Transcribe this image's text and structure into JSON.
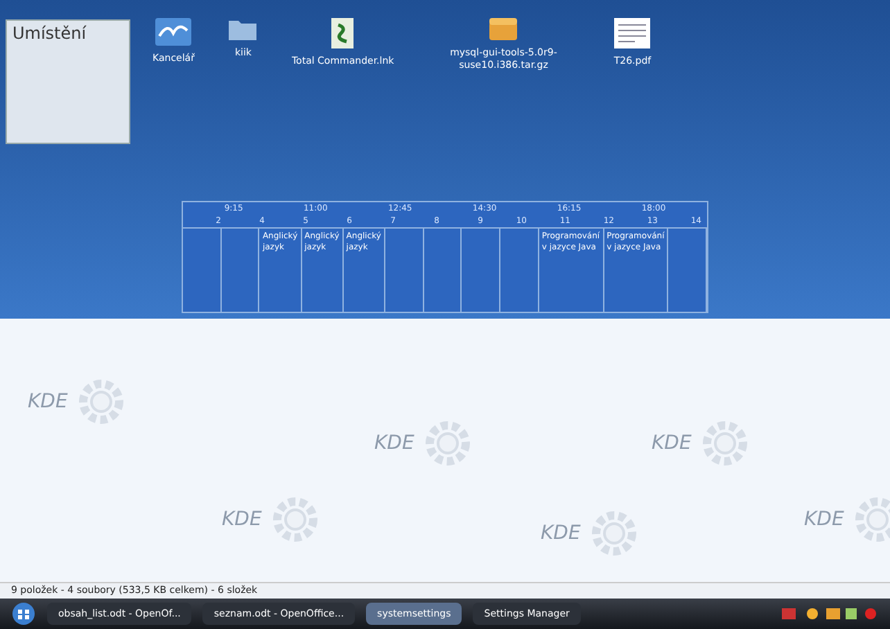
{
  "desktop_icons": [
    {
      "label": "Kancelář",
      "kind": "app"
    },
    {
      "label": "kiik",
      "kind": "folder"
    },
    {
      "label": "Total Commander.lnk",
      "kind": "shortcut"
    },
    {
      "label": "mysql-gui-tools-5.0r9-suse10.i386.tar.gz",
      "kind": "archive"
    },
    {
      "label": "T26.pdf",
      "kind": "document"
    }
  ],
  "side_window": {
    "title": "Umístění"
  },
  "timetable": {
    "times": [
      "9:15",
      "11:00",
      "12:45",
      "14:30",
      "16:15",
      "18:00"
    ],
    "periods": [
      "2",
      "4",
      "5",
      "6",
      "7",
      "8",
      "9",
      "10",
      "11",
      "12",
      "13",
      "14"
    ],
    "cells": [
      {},
      {},
      {
        "text": "Anglický jazyk"
      },
      {
        "text": "Anglický jazyk"
      },
      {
        "text": "Anglický jazyk"
      },
      {},
      {},
      {},
      {},
      {
        "text": "Programování v jazyce Java"
      },
      {
        "text": "Programování v jazyce Java"
      },
      {}
    ]
  },
  "logos": [
    "KDE",
    "KDE",
    "KDE",
    "KDE",
    "KDE",
    "KDE"
  ],
  "status_bar": {
    "text": "9 položek - 4 soubory (533,5 KB celkem) - 6 složek"
  },
  "taskbar": {
    "tasks": [
      {
        "label": "obsah_list.odt - OpenOf...",
        "selected": false
      },
      {
        "label": "seznam.odt - OpenOffice...",
        "selected": false
      },
      {
        "label": "systemsettings",
        "selected": true
      },
      {
        "label": "Settings Manager",
        "selected": false
      }
    ]
  }
}
